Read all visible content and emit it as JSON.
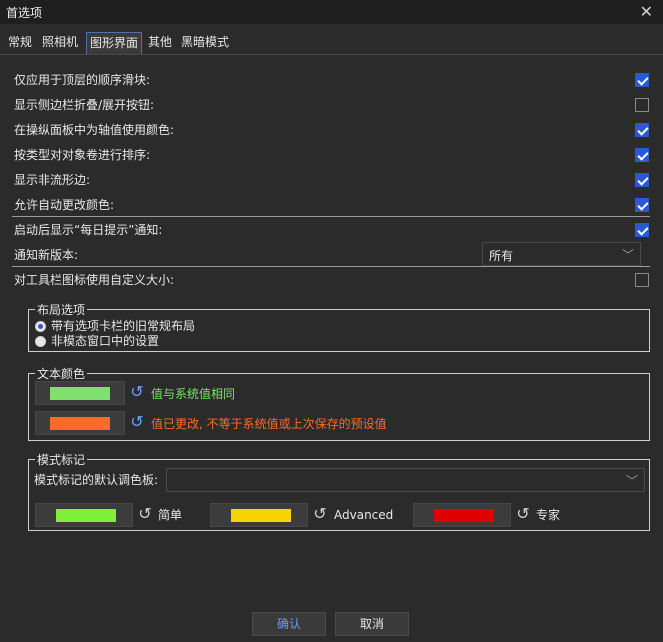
{
  "window": {
    "title": "首选项",
    "close_glyph": "✕"
  },
  "tabs": [
    {
      "label": "常规"
    },
    {
      "label": "照相机"
    },
    {
      "label": "图形界面",
      "active": true
    },
    {
      "label": "其他"
    },
    {
      "label": "黑暗模式"
    }
  ],
  "options": [
    {
      "label": "仅应用于顶层的顺序滑块:",
      "checked": true
    },
    {
      "label": "显示侧边栏折叠/展开按钮:",
      "checked": false
    },
    {
      "label": "在操纵面板中为轴值使用颜色:",
      "checked": true
    },
    {
      "label": "按类型对对象卷进行排序:",
      "checked": true
    },
    {
      "label": "显示非流形边:",
      "checked": true
    },
    {
      "label": "允许自动更改颜色:",
      "checked": true
    },
    {
      "label": "启动后显示“每日提示”通知:",
      "checked": true
    }
  ],
  "notify": {
    "label": "通知新版本:",
    "value": "所有"
  },
  "custom_icon": {
    "label": "对工具栏图标使用自定义大小:",
    "checked": false
  },
  "layout_group": {
    "title": "布局选项",
    "options": [
      {
        "label": "带有选项卡栏的旧常规布局",
        "selected": true
      },
      {
        "label": "非模态窗口中的设置",
        "selected": false
      }
    ]
  },
  "text_color_group": {
    "title": "文本颜色",
    "items": [
      {
        "swatch": "#7fe06e",
        "label": "值与系统值相同",
        "label_color": "#7fe06e"
      },
      {
        "swatch": "#ff6a2a",
        "label": "值已更改, 不等于系统值或上次保存的预设值",
        "label_color": "#ff6a2a"
      }
    ]
  },
  "mode_group": {
    "title": "模式标记",
    "palette_label": "模式标记的默认调色板:",
    "palette_value": "",
    "items": [
      {
        "swatch": "#7ff03a",
        "label": "简单"
      },
      {
        "swatch": "#f5d400",
        "label": "Advanced"
      },
      {
        "swatch": "#e00000",
        "label": "专家"
      }
    ]
  },
  "buttons": {
    "ok": "确认",
    "cancel": "取消"
  },
  "icons": {
    "reset": "reset-icon",
    "dropdown": "chevron-down-icon"
  }
}
